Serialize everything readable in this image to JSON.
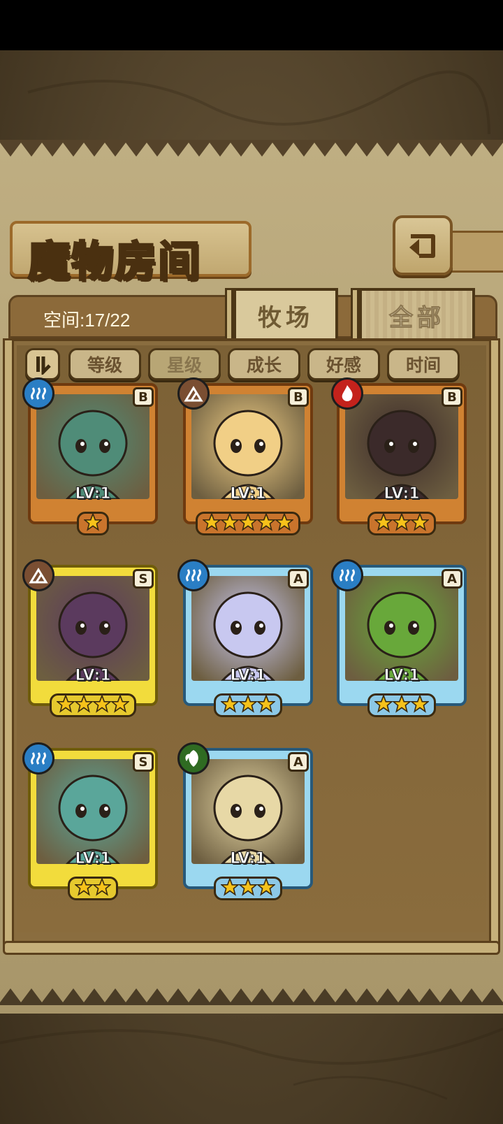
{
  "screen": {
    "title": "魔物房间"
  },
  "header": {
    "space_label": "空间:17/22"
  },
  "tabs": [
    {
      "label": "牧场",
      "active": true
    },
    {
      "label": "全部",
      "active": false
    }
  ],
  "sort": {
    "order_icon": "sort-order-icon",
    "buttons": [
      {
        "label": "等级",
        "active": false
      },
      {
        "label": "星级",
        "active": true
      },
      {
        "label": "成长",
        "active": false
      },
      {
        "label": "好感",
        "active": false
      },
      {
        "label": "时间",
        "active": false
      }
    ]
  },
  "monsters": [
    {
      "rank": "B",
      "element": "water",
      "level": "LV:1",
      "stars": 1,
      "portrait_color": "#4f8c78"
    },
    {
      "rank": "B",
      "element": "earth",
      "level": "LV:1",
      "stars": 5,
      "portrait_color": "#f1cf86"
    },
    {
      "rank": "B",
      "element": "fire",
      "level": "LV:1",
      "stars": 3,
      "portrait_color": "#3b2a2a"
    },
    {
      "rank": "S",
      "element": "earth",
      "level": "LV:1",
      "stars": 4,
      "portrait_color": "#5b3a5e"
    },
    {
      "rank": "A",
      "element": "water",
      "level": "LV:1",
      "stars": 3,
      "portrait_color": "#c8c8f0"
    },
    {
      "rank": "A",
      "element": "water",
      "level": "LV:1",
      "stars": 3,
      "portrait_color": "#68a83a"
    },
    {
      "rank": "S",
      "element": "water",
      "level": "LV:1",
      "stars": 2,
      "portrait_color": "#5aa69a"
    },
    {
      "rank": "A",
      "element": "grass",
      "level": "LV:1",
      "stars": 3,
      "portrait_color": "#e7d8a6"
    }
  ],
  "colors": {
    "accent": "#9c6a2a",
    "parchment": "#b3a173",
    "star": "#f6c21a"
  }
}
